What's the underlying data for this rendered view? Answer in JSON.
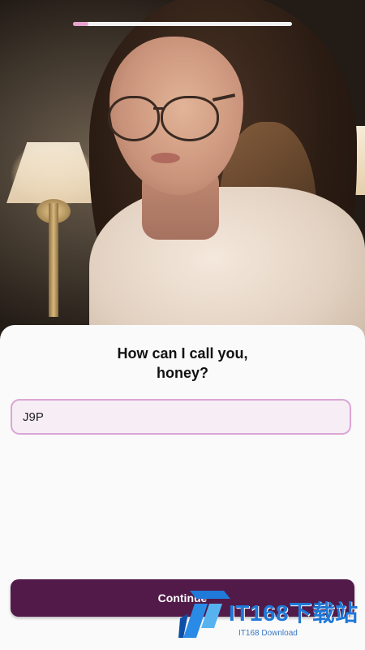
{
  "progress": {
    "value": 0.07
  },
  "prompt": {
    "line1": "How can I call you,",
    "line2": "honey?"
  },
  "name_input": {
    "value": "J9P"
  },
  "continue_button": {
    "label": "Continue"
  },
  "watermark": {
    "main": "IT168下载站",
    "sub": "IT168 Download"
  },
  "colors": {
    "primary": "#511a49",
    "progress_fill": "#e6a3cd",
    "input_border": "#dba5d6",
    "input_bg": "#f6eef4",
    "sheet_bg": "#fafafa"
  }
}
